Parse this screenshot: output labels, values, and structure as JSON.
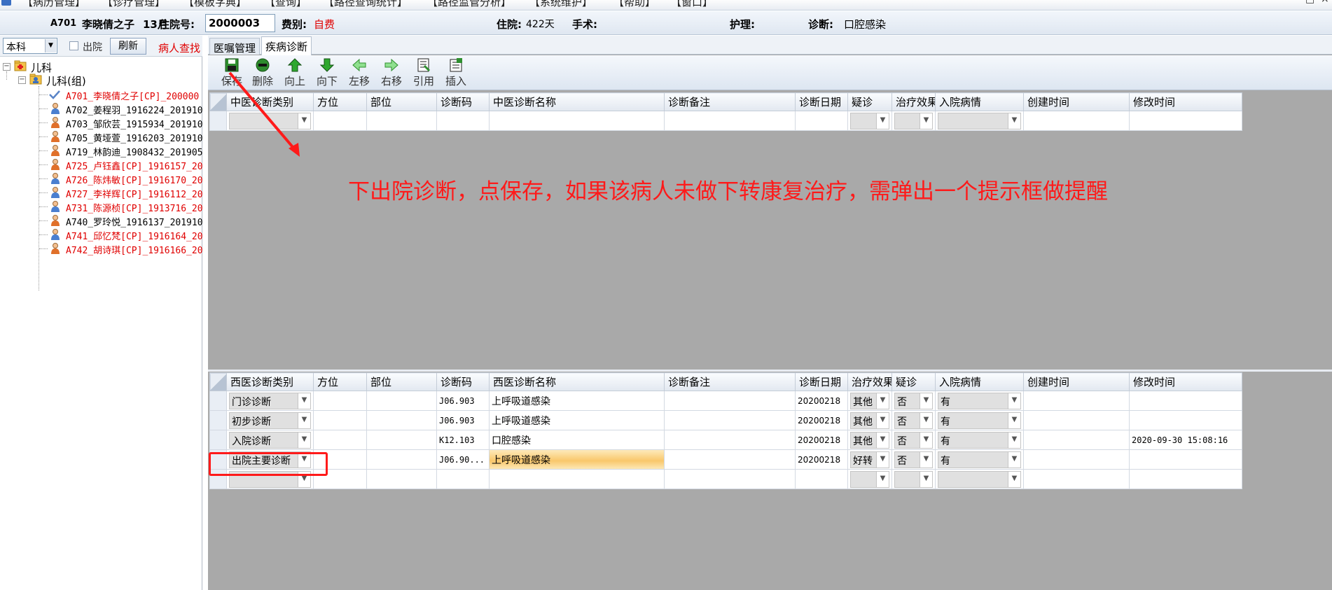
{
  "menu": {
    "items": [
      "【病历管理】",
      "【诊疗管理】",
      "【模板字典】",
      "【查询】",
      "【路径查询统计】",
      "【路径监管分析】",
      "【系统维护】",
      "【帮助】",
      "【窗口】"
    ],
    "window_buttons": [
      "–",
      "□",
      "×"
    ]
  },
  "patient_bar": {
    "bed": "A701",
    "name": "李晓倩之子",
    "age": "13月",
    "inpatient_label": "住院号:",
    "inpatient_no": "2000003",
    "fee_label": "费别:",
    "fee_value": "自费",
    "stay_label": "住院:",
    "stay_value": "422天",
    "surgery_label": "手术:",
    "surgery_value": "",
    "nursing_label": "护理:",
    "nursing_value": "",
    "diagnosis_label": "诊断:",
    "diagnosis_value": "口腔感染"
  },
  "left_panel": {
    "dept_select": "本科",
    "discharged_label": "出院",
    "discharged_checked": false,
    "refresh_label": "刷新",
    "search_label": "病人查找",
    "tree": {
      "root": "儿科",
      "group": "儿科(组)",
      "patients": [
        {
          "label": "A701_李晓倩之子[CP]_200000",
          "red": true,
          "icon": "check-icon"
        },
        {
          "label": "A702_姜程羽_1916224_201910",
          "red": false,
          "icon": "patient-male-icon"
        },
        {
          "label": "A703_邹欣芸_1915934_201910",
          "red": false,
          "icon": "patient-female-icon"
        },
        {
          "label": "A705_黄垭萱_1916203_201910",
          "red": false,
          "icon": "patient-female-icon"
        },
        {
          "label": "A719_林韵迪_1908432_201905",
          "red": false,
          "icon": "patient-female-icon"
        },
        {
          "label": "A725_卢钰鑫[CP]_1916157_20",
          "red": true,
          "icon": "patient-female-icon"
        },
        {
          "label": "A726_陈炜敏[CP]_1916170_20",
          "red": true,
          "icon": "patient-male-icon"
        },
        {
          "label": "A727_李祥辉[CP]_1916112_20",
          "red": true,
          "icon": "patient-male-icon"
        },
        {
          "label": "A731_陈源桢[CP]_1913716_20",
          "red": true,
          "icon": "patient-male-icon"
        },
        {
          "label": "A740_罗玲悦_1916137_201910",
          "red": false,
          "icon": "patient-female-icon"
        },
        {
          "label": "A741_邱忆梵[CP]_1916164_20",
          "red": true,
          "icon": "patient-male-icon"
        },
        {
          "label": "A742_胡诗琪[CP]_1916166_20",
          "red": true,
          "icon": "patient-female-icon"
        }
      ]
    }
  },
  "tabs": [
    "医嘱管理",
    "疾病诊断"
  ],
  "toolbar": {
    "buttons": [
      {
        "label": "保存",
        "icon": "save-icon"
      },
      {
        "label": "删除",
        "icon": "delete-icon"
      },
      {
        "label": "向上",
        "icon": "arrow-up-icon"
      },
      {
        "label": "向下",
        "icon": "arrow-down-icon"
      },
      {
        "label": "左移",
        "icon": "arrow-left-icon"
      },
      {
        "label": "右移",
        "icon": "arrow-right-icon"
      },
      {
        "label": "引用",
        "icon": "quote-icon"
      },
      {
        "label": "插入",
        "icon": "insert-icon"
      }
    ]
  },
  "tcm_grid": {
    "headers": [
      "中医诊断类别",
      "方位",
      "部位",
      "诊断码",
      "中医诊断名称",
      "诊断备注",
      "诊断日期",
      "疑诊",
      "治疗效果",
      "入院病情",
      "创建时间",
      "修改时间"
    ]
  },
  "western_grid": {
    "headers": [
      "西医诊断类别",
      "方位",
      "部位",
      "诊断码",
      "西医诊断名称",
      "诊断备注",
      "诊断日期",
      "治疗效果",
      "疑诊",
      "入院病情",
      "创建时间",
      "修改时间"
    ],
    "rows": [
      {
        "category": "门诊诊断",
        "side": "",
        "site": "",
        "code": "J06.903",
        "name": "上呼吸道感染",
        "note": "",
        "date": "20200218",
        "effect": "其他",
        "suspect": "否",
        "admit": "有",
        "created": "",
        "modified": ""
      },
      {
        "category": "初步诊断",
        "side": "",
        "site": "",
        "code": "J06.903",
        "name": "上呼吸道感染",
        "note": "",
        "date": "20200218",
        "effect": "其他",
        "suspect": "否",
        "admit": "有",
        "created": "",
        "modified": ""
      },
      {
        "category": "入院诊断",
        "side": "",
        "site": "",
        "code": "K12.103",
        "name": "口腔感染",
        "note": "",
        "date": "20200218",
        "effect": "其他",
        "suspect": "否",
        "admit": "有",
        "created": "",
        "modified": "2020-09-30 15:08:16"
      },
      {
        "category": "出院主要诊断",
        "side": "",
        "site": "",
        "code": "J06.90...",
        "name": "上呼吸道感染",
        "note": "",
        "date": "20200218",
        "effect": "好转",
        "suspect": "否",
        "admit": "有",
        "created": "",
        "modified": ""
      }
    ]
  },
  "annotation": {
    "text": "下出院诊断，点保存，如果该病人未做下转康复治疗，需弹出一个提示框做提醒",
    "color": "#ff1a1a"
  }
}
